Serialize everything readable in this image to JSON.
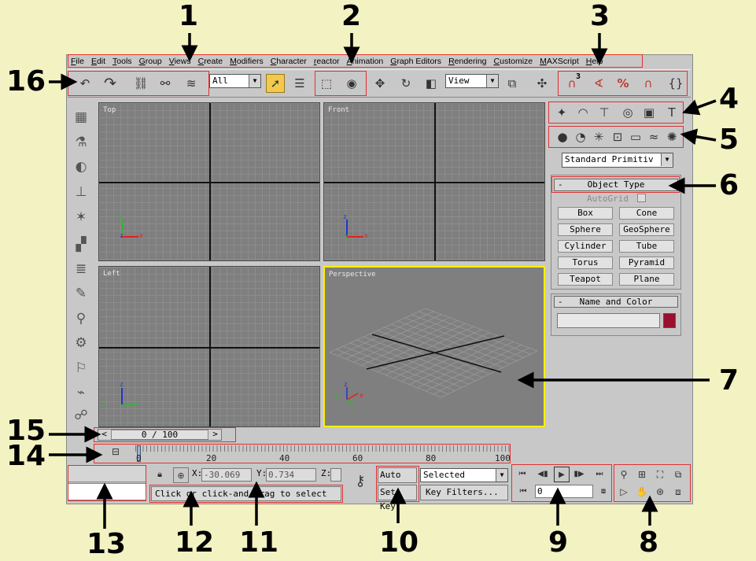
{
  "menu": [
    "File",
    "Edit",
    "Tools",
    "Group",
    "Views",
    "Create",
    "Modifiers",
    "Character",
    "reactor",
    "Animation",
    "Graph Editors",
    "Rendering",
    "Customize",
    "MAXScript",
    "Help"
  ],
  "toolbar": {
    "selection_filter": "All",
    "reference_coord": "View",
    "snap_angle_label": "3"
  },
  "viewports": {
    "top": "Top",
    "front": "Front",
    "left": "Left",
    "perspective": "Perspective"
  },
  "axis": {
    "x": "x",
    "y": "y",
    "z": "z"
  },
  "command_panel": {
    "category": "Standard Primitiv",
    "object_type_title": "Object Type",
    "rollout_toggle": "-",
    "autogrid": "AutoGrid",
    "buttons": [
      "Box",
      "Cone",
      "Sphere",
      "GeoSphere",
      "Cylinder",
      "Tube",
      "Torus",
      "Pyramid",
      "Teapot",
      "Plane"
    ],
    "name_color_title": "Name and Color",
    "color": "#9a1030"
  },
  "timeline": {
    "frame_display": "0 / 100",
    "ticks": [
      "0",
      "20",
      "40",
      "60",
      "80",
      "100"
    ]
  },
  "status": {
    "x_label": "X:",
    "x_value": "-30.069",
    "y_label": "Y:",
    "y_value": "0.734",
    "z_label": "Z:",
    "prompt": "Click or click-and-drag to select"
  },
  "anim": {
    "auto_key": "Auto Key",
    "set_key": "Set Key",
    "key_mode": "Selected",
    "key_filters": "Key Filters...",
    "current_frame": "0"
  },
  "annotations": [
    "1",
    "2",
    "3",
    "4",
    "5",
    "6",
    "7",
    "8",
    "9",
    "10",
    "11",
    "12",
    "13",
    "14",
    "15",
    "16"
  ],
  "colors": {
    "background": "#f2f2c2",
    "highlight": "#e23030",
    "perspective_border": "#ffef00"
  }
}
